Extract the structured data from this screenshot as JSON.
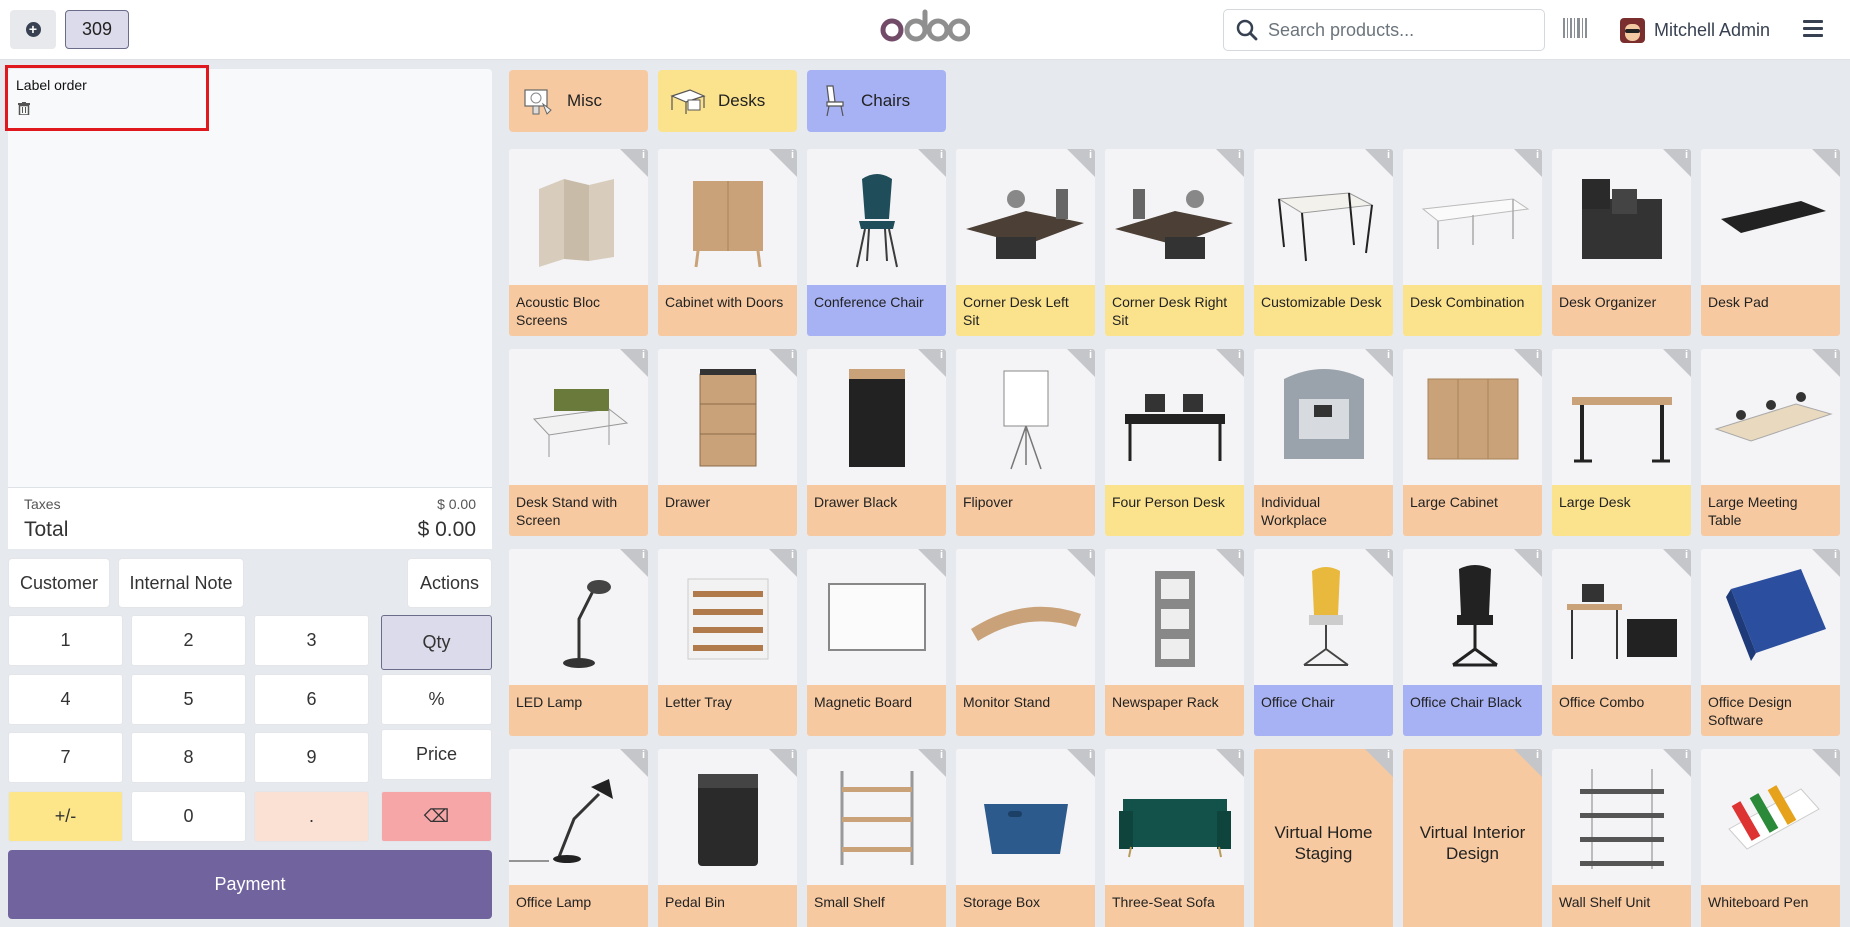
{
  "header": {
    "order_number": "309",
    "search_placeholder": "Search products...",
    "user_name": "Mitchell Admin"
  },
  "order": {
    "label": "Label order",
    "taxes_label": "Taxes",
    "taxes_value": "$ 0.00",
    "total_label": "Total",
    "total_value": "$ 0.00"
  },
  "controls": {
    "customer": "Customer",
    "internal_note": "Internal Note",
    "actions": "Actions"
  },
  "numpad": {
    "k1": "1",
    "k2": "2",
    "k3": "3",
    "qty": "Qty",
    "k4": "4",
    "k5": "5",
    "k6": "6",
    "percent": "%",
    "k7": "7",
    "k8": "8",
    "k9": "9",
    "price": "Price",
    "plusminus": "+/-",
    "k0": "0",
    "dot": ".",
    "backspace": "⌫"
  },
  "payment_label": "Payment",
  "categories": [
    {
      "label": "Misc",
      "color": "#f7c9a0"
    },
    {
      "label": "Desks",
      "color": "#fbe38e"
    },
    {
      "label": "Chairs",
      "color": "#a7b2f4"
    }
  ],
  "products": [
    {
      "name": "Acoustic Bloc Screens",
      "cat": "misc"
    },
    {
      "name": "Cabinet with Doors",
      "cat": "misc"
    },
    {
      "name": "Conference Chair",
      "cat": "chair"
    },
    {
      "name": "Corner Desk Left Sit",
      "cat": "desk"
    },
    {
      "name": "Corner Desk Right Sit",
      "cat": "desk"
    },
    {
      "name": "Customizable Desk",
      "cat": "desk"
    },
    {
      "name": "Desk Combination",
      "cat": "desk"
    },
    {
      "name": "Desk Organizer",
      "cat": "misc"
    },
    {
      "name": "Desk Pad",
      "cat": "misc"
    },
    {
      "name": "Desk Stand with Screen",
      "cat": "misc"
    },
    {
      "name": "Drawer",
      "cat": "misc"
    },
    {
      "name": "Drawer Black",
      "cat": "misc"
    },
    {
      "name": "Flipover",
      "cat": "misc"
    },
    {
      "name": "Four Person Desk",
      "cat": "desk"
    },
    {
      "name": "Individual Workplace",
      "cat": "misc"
    },
    {
      "name": "Large Cabinet",
      "cat": "misc"
    },
    {
      "name": "Large Desk",
      "cat": "desk"
    },
    {
      "name": "Large Meeting Table",
      "cat": "misc"
    },
    {
      "name": "LED Lamp",
      "cat": "misc"
    },
    {
      "name": "Letter Tray",
      "cat": "misc"
    },
    {
      "name": "Magnetic Board",
      "cat": "misc"
    },
    {
      "name": "Monitor Stand",
      "cat": "misc"
    },
    {
      "name": "Newspaper Rack",
      "cat": "misc"
    },
    {
      "name": "Office Chair",
      "cat": "chair"
    },
    {
      "name": "Office Chair Black",
      "cat": "chair"
    },
    {
      "name": "Office Combo",
      "cat": "misc"
    },
    {
      "name": "Office Design Software",
      "cat": "misc"
    },
    {
      "name": "Office Lamp",
      "cat": "misc"
    },
    {
      "name": "Pedal Bin",
      "cat": "misc"
    },
    {
      "name": "Small Shelf",
      "cat": "misc"
    },
    {
      "name": "Storage Box",
      "cat": "misc"
    },
    {
      "name": "Three-Seat Sofa",
      "cat": "misc"
    },
    {
      "name": "Virtual Home Staging",
      "cat": "misc"
    },
    {
      "name": "Virtual Interior Design",
      "cat": "misc"
    },
    {
      "name": "Wall Shelf Unit",
      "cat": "misc"
    },
    {
      "name": "Whiteboard Pen",
      "cat": "misc"
    }
  ],
  "colors": {
    "misc": "#f7c9a0",
    "desk": "#fbe38e",
    "chair": "#a7b2f4",
    "payment": "#71639e"
  }
}
